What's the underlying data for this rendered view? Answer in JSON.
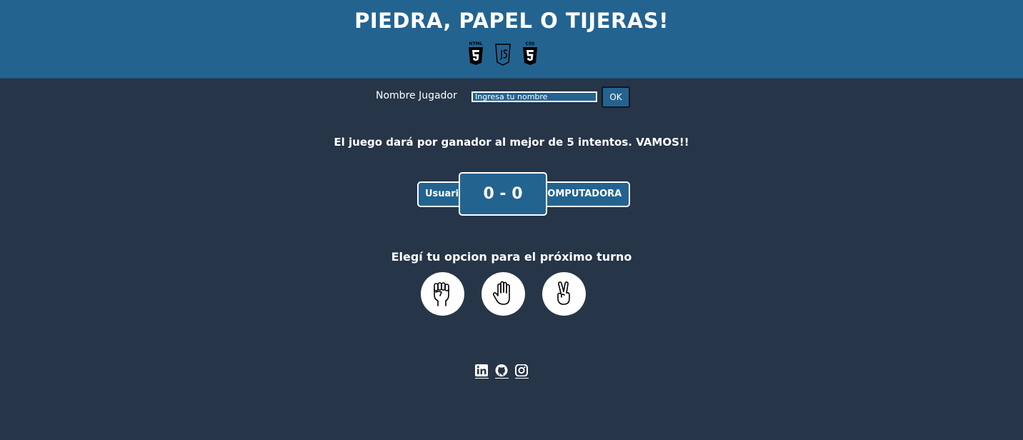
{
  "header": {
    "title": "PIEDRA, PAPEL O TIJERAS!",
    "tech_icons": [
      {
        "name": "html5-icon",
        "label": "HTML"
      },
      {
        "name": "js-icon",
        "label": "JS"
      },
      {
        "name": "css3-icon",
        "label": "CSS"
      }
    ]
  },
  "player": {
    "label": "Nombre Jugador",
    "input_placeholder": "Ingresa tu nombre",
    "input_value": "",
    "ok_label": "OK"
  },
  "rules_text": "El juego dará por ganador al mejor de 5 intentos. VAMOS!!",
  "scoreboard": {
    "user_label": "Usuario",
    "score": "0 - 0",
    "computer_label": "COMPUTADORA"
  },
  "choices": {
    "title": "Elegí tu opcion para el próximo turno",
    "options": [
      {
        "name": "rock",
        "icon": "fist-icon"
      },
      {
        "name": "paper",
        "icon": "open-hand-icon"
      },
      {
        "name": "scissors",
        "icon": "victory-hand-icon"
      }
    ]
  },
  "social_links": [
    {
      "name": "linkedin",
      "icon": "linkedin-icon"
    },
    {
      "name": "github",
      "icon": "github-icon"
    },
    {
      "name": "instagram",
      "icon": "instagram-icon"
    }
  ],
  "colors": {
    "background": "#263548",
    "header": "#236390",
    "text": "#ffffff",
    "accent": "#236390"
  }
}
